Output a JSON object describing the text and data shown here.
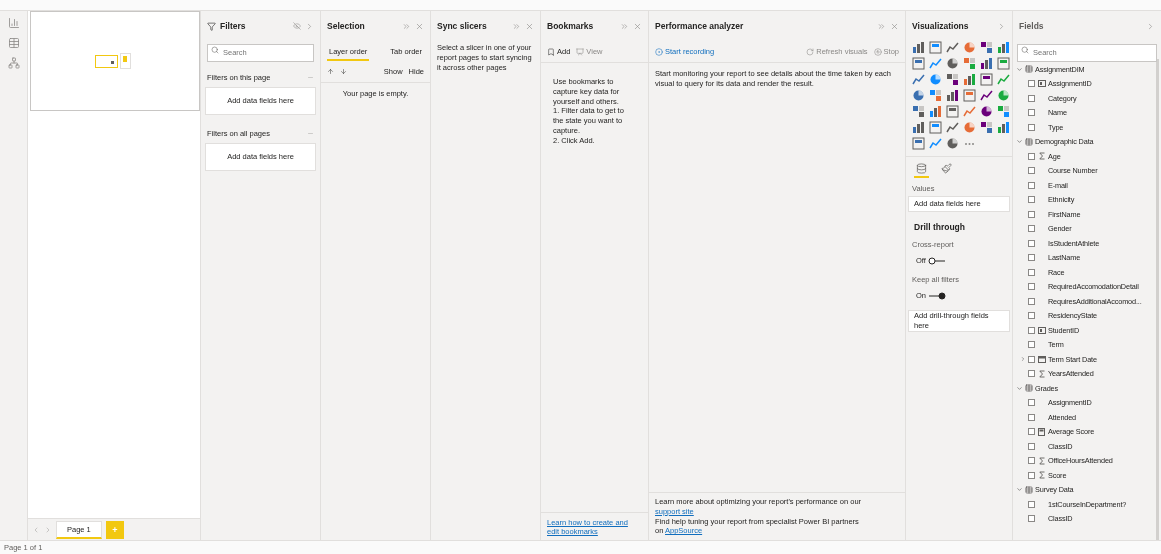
{
  "pages": {
    "tabs": [
      {
        "label": "Page 1",
        "selected": true
      }
    ],
    "add_button": "+"
  },
  "status_bar": "Page 1 of 1",
  "filters": {
    "title": "Filters",
    "search": {
      "placeholder": "Search"
    },
    "sections": [
      {
        "title": "Filters on this page",
        "hint": "Add data fields here"
      },
      {
        "title": "Filters on all pages",
        "hint": "Add data fields here"
      }
    ]
  },
  "selection": {
    "title": "Selection",
    "tabs": [
      {
        "label": "Layer order",
        "selected": true
      },
      {
        "label": "Tab order",
        "selected": false
      }
    ],
    "show": "Show",
    "hide": "Hide",
    "empty": "Your page is empty."
  },
  "sync_slicers": {
    "title": "Sync slicers",
    "message": "Select a slicer in one of your report pages to start syncing it across other pages"
  },
  "bookmarks": {
    "title": "Bookmarks",
    "actions": [
      {
        "label": "Add",
        "disabled": false
      },
      {
        "label": "View",
        "disabled": true
      }
    ],
    "help": [
      "Use bookmarks to capture key data for yourself and others.",
      "1. Filter data to get to the state you want to capture.",
      "2. Click Add."
    ],
    "link": "Learn how to create and edit bookmarks"
  },
  "performance": {
    "title": "Performance analyzer",
    "actions": [
      {
        "kind": "record",
        "label": "Start recording",
        "disabled": false
      },
      {
        "kind": "refresh",
        "label": "Refresh visuals",
        "disabled": true
      },
      {
        "kind": "stop",
        "label": "Stop",
        "disabled": true
      }
    ],
    "message": "Start monitoring your report to see details about the time taken by each visual to query for its data and render the result.",
    "footer": [
      [
        {
          "kind": "text",
          "text": "Learn more about optimizing your report's performance on our "
        },
        {
          "kind": "link",
          "text": "support site"
        }
      ],
      [
        {
          "kind": "text",
          "text": "Find help tuning your report from specialist Power BI partners"
        }
      ],
      [
        {
          "kind": "text",
          "text": "on "
        },
        {
          "kind": "link",
          "text": "AppSource"
        }
      ]
    ]
  },
  "visualizations": {
    "title": "Visualizations",
    "tabs": [
      {
        "kind": "fields",
        "selected": true
      },
      {
        "kind": "format",
        "selected": false
      }
    ],
    "values_label": "Values",
    "values_hint": "Add data fields here",
    "drill_title": "Drill through",
    "toggles": [
      {
        "label": "Cross-report",
        "state": "Off",
        "on": false
      },
      {
        "label": "Keep all filters",
        "state": "On",
        "on": true
      }
    ],
    "drill_hint": "Add drill-through fields here"
  },
  "fields": {
    "title": "Fields",
    "search": {
      "placeholder": "Search"
    },
    "tables": [
      {
        "name": "AssignmentDIM",
        "expanded": true,
        "fields": [
          {
            "name": "AssignmentID",
            "kind": "id",
            "checked": false
          },
          {
            "name": "Category",
            "kind": "plain",
            "checked": false
          },
          {
            "name": "Name",
            "kind": "plain",
            "checked": false
          },
          {
            "name": "Type",
            "kind": "plain",
            "checked": false
          }
        ]
      },
      {
        "name": "Demographic Data",
        "expanded": true,
        "fields": [
          {
            "name": "Age",
            "kind": "sigma",
            "checked": false
          },
          {
            "name": "Course Number",
            "kind": "plain",
            "checked": false
          },
          {
            "name": "E-mail",
            "kind": "plain",
            "checked": false
          },
          {
            "name": "Ethnicity",
            "kind": "plain",
            "checked": false
          },
          {
            "name": "FirstName",
            "kind": "plain",
            "checked": false
          },
          {
            "name": "Gender",
            "kind": "plain",
            "checked": false
          },
          {
            "name": "IsStudentAthlete",
            "kind": "plain",
            "checked": false
          },
          {
            "name": "LastName",
            "kind": "plain",
            "checked": false
          },
          {
            "name": "Race",
            "kind": "plain",
            "checked": false
          },
          {
            "name": "RequiredAccomodationDetail",
            "kind": "plain",
            "checked": false
          },
          {
            "name": "RequiresAdditionalAccomod...",
            "kind": "plain",
            "checked": false
          },
          {
            "name": "ResidencyState",
            "kind": "plain",
            "checked": false
          },
          {
            "name": "StudentID",
            "kind": "id",
            "checked": false
          },
          {
            "name": "Term",
            "kind": "plain",
            "checked": false
          },
          {
            "name": "Term Start Date",
            "kind": "date",
            "checked": false
          },
          {
            "name": "YearsAttended",
            "kind": "sigma",
            "checked": false
          }
        ]
      },
      {
        "name": "Grades",
        "expanded": true,
        "fields": [
          {
            "name": "AssignmentID",
            "kind": "plain",
            "checked": false
          },
          {
            "name": "Attended",
            "kind": "plain",
            "checked": false
          },
          {
            "name": "Average Score",
            "kind": "measure",
            "checked": false
          },
          {
            "name": "ClassID",
            "kind": "plain",
            "checked": false
          },
          {
            "name": "OfficeHoursAttended",
            "kind": "sigma",
            "checked": false
          },
          {
            "name": "Score",
            "kind": "sigma",
            "checked": false
          }
        ]
      },
      {
        "name": "Survey Data",
        "expanded": true,
        "fields": [
          {
            "name": "1stCourseInDepartment?",
            "kind": "plain",
            "checked": false
          },
          {
            "name": "ClassID",
            "kind": "plain",
            "checked": false
          }
        ]
      }
    ]
  }
}
